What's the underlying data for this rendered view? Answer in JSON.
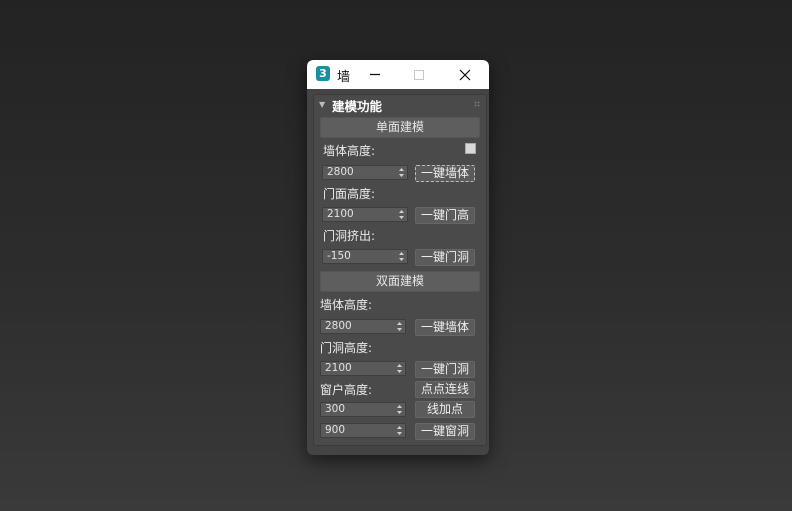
{
  "window": {
    "icon_text": "3",
    "title": "墙"
  },
  "section": {
    "title": "建模功能"
  },
  "single": {
    "header_button": "单面建模",
    "wall_height_label": "墙体高度:",
    "wall_height_value": "2800",
    "wall_button": "一键墙体",
    "door_face_label": "门面高度:",
    "door_face_value": "2100",
    "door_face_button": "一键门高",
    "door_extrude_label": "门洞挤出:",
    "door_extrude_value": "-150",
    "door_extrude_button": "一键门洞"
  },
  "double": {
    "header_button": "双面建模",
    "wall_height_label": "墙体高度:",
    "wall_height_value": "2800",
    "wall_button": "一键墙体",
    "door_height_label": "门洞高度:",
    "door_height_value": "2100",
    "door_button": "一键门洞",
    "window_height_label": "窗户高度:",
    "connect_button": "点点连线",
    "window_value_1": "300",
    "add_point_button": "线加点",
    "window_value_2": "900",
    "window_button": "一键窗洞"
  }
}
